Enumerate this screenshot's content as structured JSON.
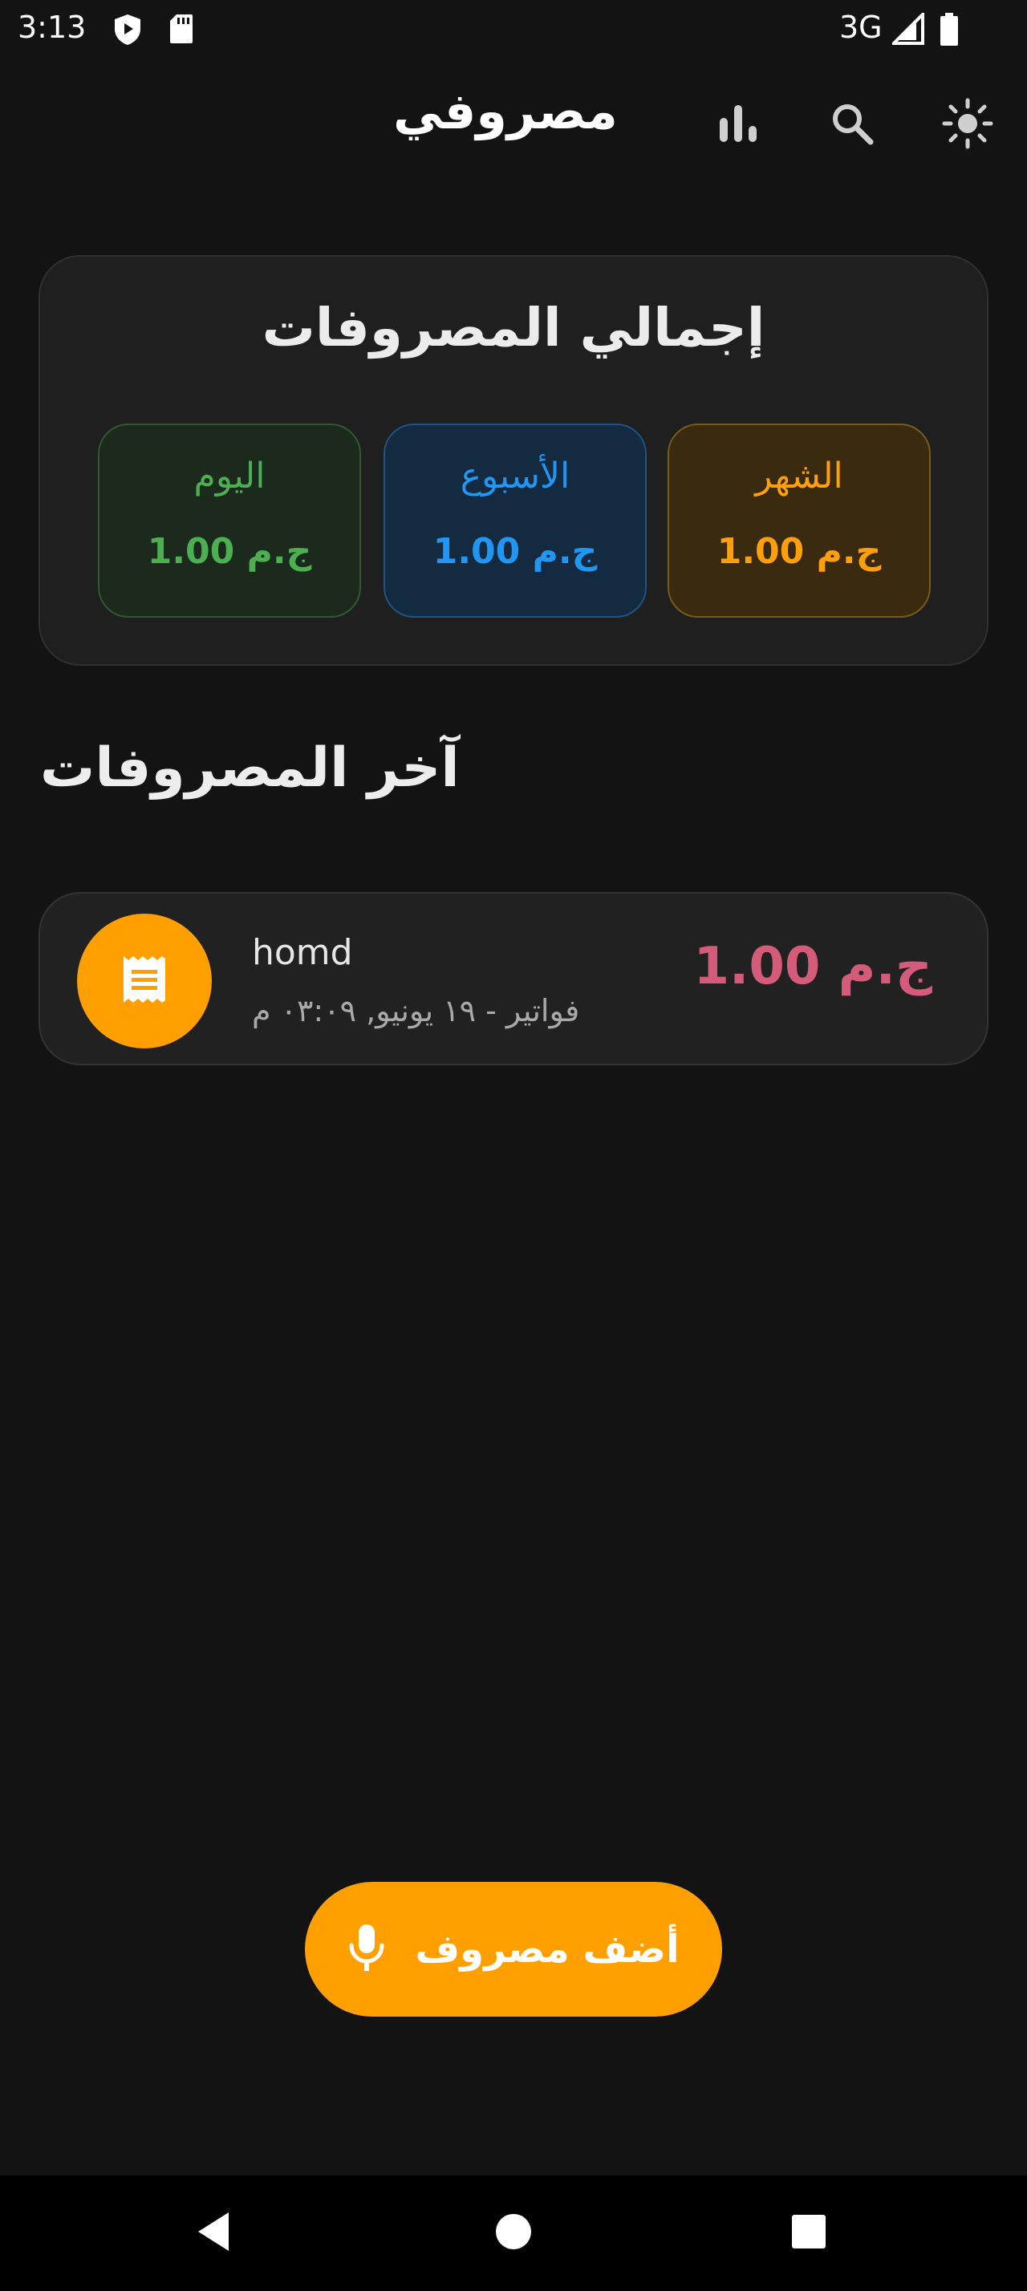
{
  "status_bar": {
    "time": "3:13",
    "network": "3G"
  },
  "app_bar": {
    "title": "مصروفي",
    "actions": [
      "stats-icon",
      "search-icon",
      "brightness-icon"
    ]
  },
  "totals": {
    "title": "إجمالي المصروفات",
    "periods": [
      {
        "label": "الشهر",
        "value": "ج.م 1.00",
        "color": "#ff9f0a"
      },
      {
        "label": "الأسبوع",
        "value": "ج.م 1.00",
        "color": "#2196f3"
      },
      {
        "label": "اليوم",
        "value": "ج.م 1.00",
        "color": "#4caf50"
      }
    ]
  },
  "recent": {
    "title": "آخر المصروفات",
    "items": [
      {
        "name": "homd",
        "meta": "فواتير - ١٩ يونيو, ٠٣:٠٩ م",
        "amount": "ج.م 1.00",
        "icon": "receipt-icon",
        "icon_bg": "#ffa000",
        "amount_color": "#d45b7a"
      }
    ]
  },
  "fab": {
    "label": "أضف مصروف",
    "icon": "mic-icon",
    "color": "#ffa000"
  },
  "nav": [
    "back-icon",
    "home-icon",
    "recents-icon"
  ]
}
